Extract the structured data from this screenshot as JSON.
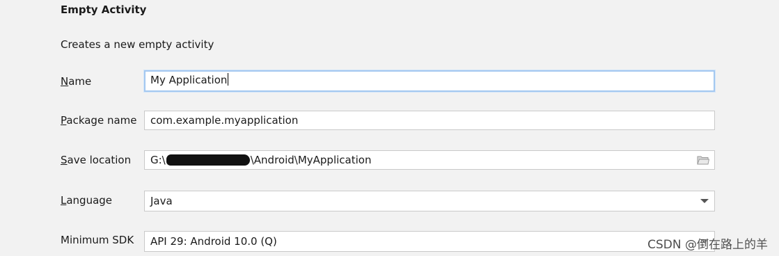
{
  "header": {
    "title": "Empty Activity",
    "description": "Creates a new empty activity"
  },
  "form": {
    "name": {
      "label_mnemonic": "N",
      "label_rest": "ame",
      "value": "My Application"
    },
    "package": {
      "label_mnemonic": "P",
      "label_rest": "ackage name",
      "value": "com.example.myapplication"
    },
    "save_location": {
      "label_mnemonic": "S",
      "label_rest": "ave location",
      "value_prefix": "G:\\",
      "value_suffix": "\\Android\\MyApplication",
      "icon": "folder-icon"
    },
    "language": {
      "label_mnemonic": "L",
      "label_rest": "anguage",
      "value": "Java"
    },
    "min_sdk": {
      "label": "Minimum SDK",
      "value": "API 29: Android 10.0 (Q)"
    }
  },
  "watermark": "CSDN @倒在路上的羊",
  "colors": {
    "background": "#f2f2f2",
    "field_border": "#c9c9c9",
    "focus_border": "#a4c8f0"
  }
}
